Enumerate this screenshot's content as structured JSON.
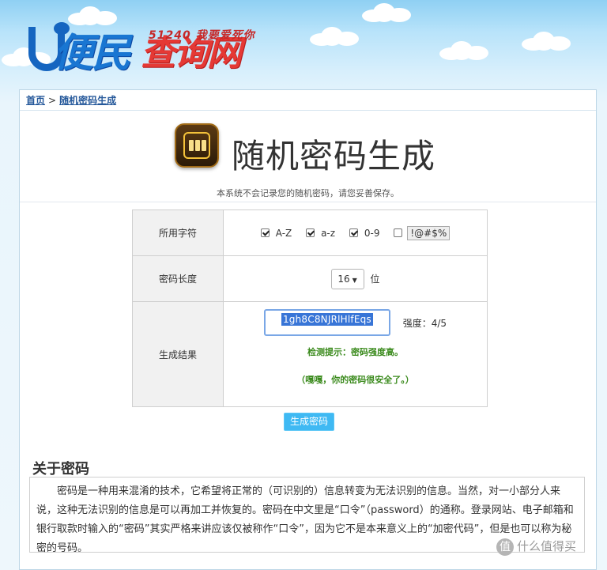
{
  "logo": {
    "slogan": "51240 我要爱死你",
    "brand_blue": "便民",
    "brand_red": "查询网"
  },
  "breadcrumb": {
    "home": "首页",
    "separator": ">",
    "current": "随机密码生成"
  },
  "page": {
    "title": "随机密码生成",
    "notice": "本系统不会记录您的随机密码，请您妥善保存。"
  },
  "form": {
    "charset_label": "所用字符",
    "options": [
      {
        "label": "A-Z",
        "checked": true
      },
      {
        "label": "a-z",
        "checked": true
      },
      {
        "label": "0-9",
        "checked": true
      },
      {
        "label": "!@#$%",
        "checked": false
      }
    ],
    "length_label": "密码长度",
    "length_value": "16",
    "length_unit": "位",
    "result_label": "生成结果",
    "password": "1gh8C8NJRlHlfEqs",
    "strength": "强度：4/5",
    "hint1": "检测提示：密码强度高。",
    "hint2": "（嘎嘎，你的密码很安全了。）",
    "generate_button": "生成密码"
  },
  "about": {
    "title": "关于密码",
    "text": "密码是一种用来混淆的技术，它希望将正常的（可识别的）信息转变为无法识别的信息。当然，对一小部分人来说，这种无法识别的信息是可以再加工并恢复的。密码在中文里是“口令”（password）的通称。登录网站、电子邮箱和银行取款时输入的“密码”其实严格来讲应该仅被称作“口令”，因为它不是本来意义上的“加密代码”，但是也可以称为秘密的号码。"
  },
  "watermark": {
    "icon_char": "值",
    "text": "什么值得买"
  },
  "colors": {
    "brand_blue": "#1976d2",
    "brand_red": "#e53935",
    "link": "#25589a",
    "button": "#3fb9f3",
    "hint_green": "#3a8a1c",
    "selection": "#3875d7"
  }
}
